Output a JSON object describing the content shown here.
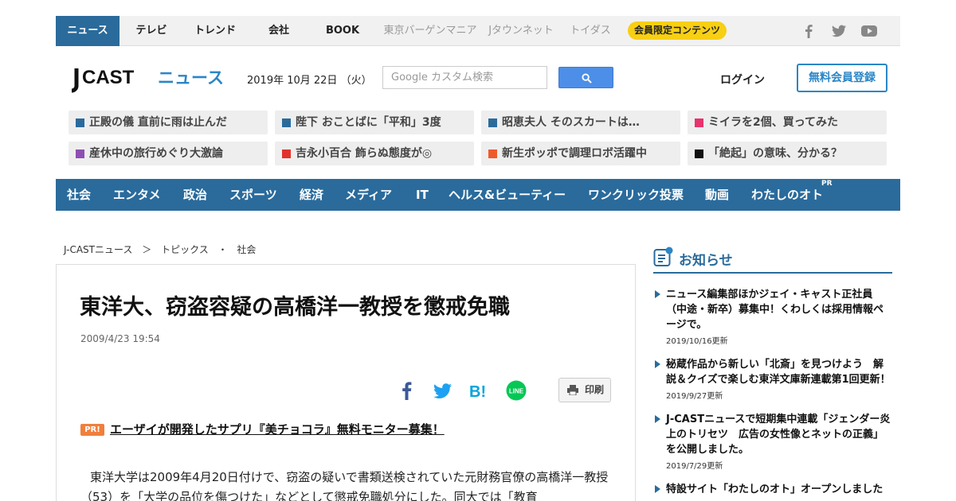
{
  "topnav": {
    "tabs": [
      "ニュース",
      "テレビ",
      "トレンド",
      "会社",
      "BOOK"
    ],
    "subtabs": [
      "東京バーゲンマニア",
      "Jタウンネット",
      "トイダス"
    ],
    "member_label": "会員限定コンテンツ",
    "social_icons": [
      "facebook-icon",
      "twitter-icon",
      "youtube-icon"
    ]
  },
  "header": {
    "logo_text": "J-CAST ニュース",
    "date": "2019年 10月 22日 （火）",
    "search_placeholder": "Google カスタム検索",
    "login_label": "ログイン",
    "register_label": "無料会員登録"
  },
  "headlines": [
    {
      "text": "正殿の儀 直前に雨は止んだ",
      "color": "#2a6b9c"
    },
    {
      "text": "陛下 おことばに「平和」3度",
      "color": "#2a6b9c"
    },
    {
      "text": "昭恵夫人 そのスカートは…",
      "color": "#2a6b9c"
    },
    {
      "text": "ミイラを2個、買ってみた",
      "color": "#e8336d"
    },
    {
      "text": "産休中の旅行めぐり大激論",
      "color": "#8e4fb2"
    },
    {
      "text": "吉永小百合 飾らぬ態度が◎",
      "color": "#e0322b"
    },
    {
      "text": "新生ポッポで調理ロボ活躍中",
      "color": "#ef5a2c"
    },
    {
      "text": "「絶起」の意味、分かる？",
      "color": "#111111"
    }
  ],
  "categories": [
    "社会",
    "エンタメ",
    "政治",
    "スポーツ",
    "経済",
    "メディア",
    "IT",
    "ヘルス&ビューティー",
    "ワンクリック投票",
    "動画",
    "わたしのオト"
  ],
  "categories_pr": "PR",
  "breadcrumb": [
    "J-CASTニュース",
    "＞",
    "トピックス",
    "・",
    "社会"
  ],
  "article": {
    "title": "東洋大、窃盗容疑の高橋洋一教授を懲戒免職",
    "date": "2009/4/23 19:54",
    "share_icons": [
      "facebook-icon",
      "twitter-icon",
      "hatena-bookmark-icon",
      "line-icon"
    ],
    "print_label": "印刷",
    "pr_badge": "PR!",
    "pr_link": "エーザイが開発したサプリ『美チョコラ』無料モニター募集！",
    "body": "東洋大学は2009年4月20日付けで、窃盗の疑いで書類送検されていた元財務官僚の高橋洋一教授（53）を「大学の品位を傷つけた」などとして懲戒免職処分にした。同大では「教育"
  },
  "sidebar": {
    "heading": "お知らせ",
    "items": [
      {
        "text": "ニュース編集部ほかジェイ・キャスト正社員（中途・新卒）募集中！くわしくは採用情報ページで。",
        "date": "2019/10/16更新"
      },
      {
        "text": "秘蔵作品から新しい「北斎」を見つけよう　解説＆クイズで楽しむ東洋文庫新連載第1回更新！",
        "date": "2019/9/27更新"
      },
      {
        "text": "J-CASTニュースで短期集中連載「ジェンダー炎上のトリセツ　広告の女性像とネットの正義」を公開しました。",
        "date": "2019/7/29更新"
      },
      {
        "text": "特設サイト「わたしのオト」オープンしました",
        "date": ""
      }
    ]
  }
}
